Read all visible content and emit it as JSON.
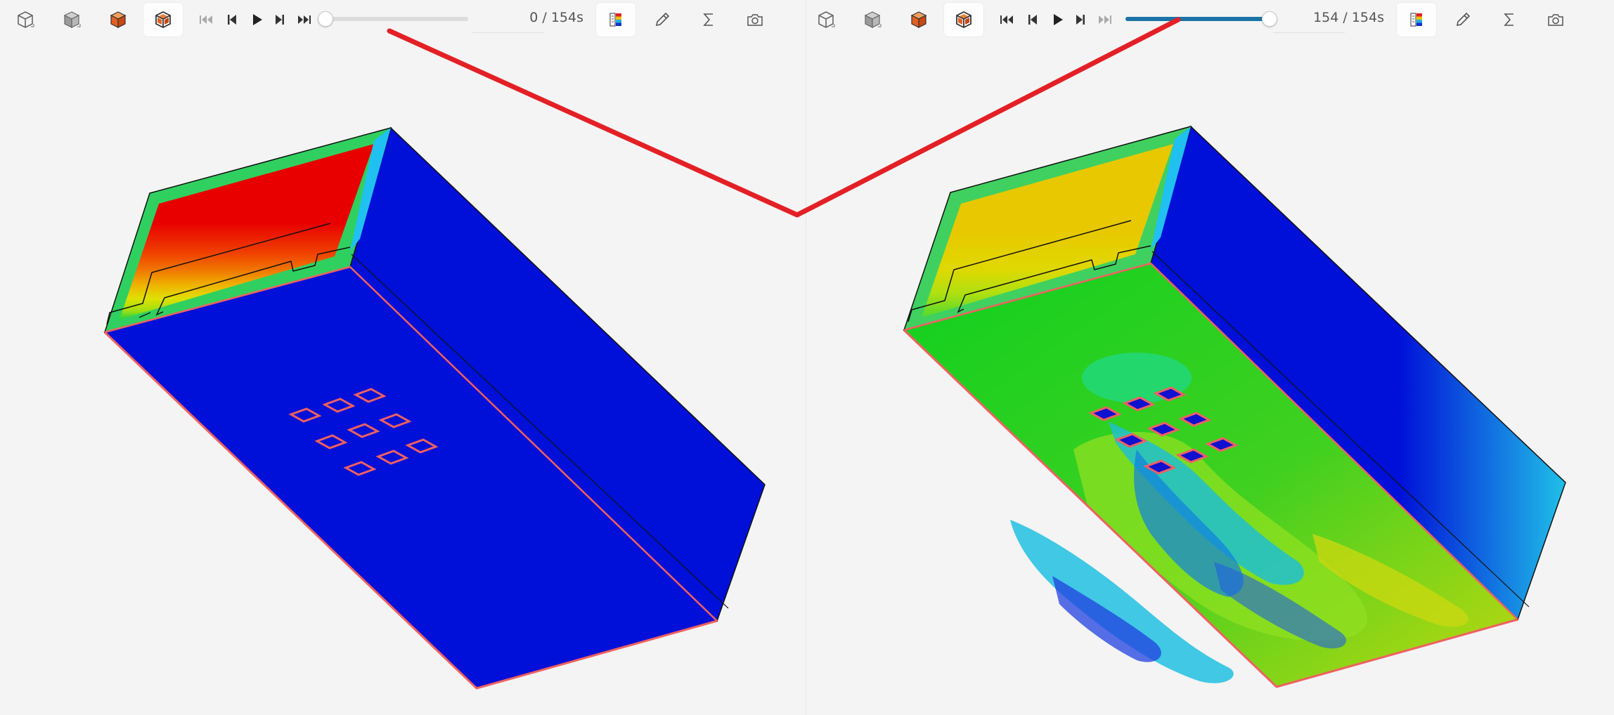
{
  "left_view": {
    "toolbar": {
      "view_buttons": [
        {
          "icon": "wireframe-cube-icon",
          "active": false
        },
        {
          "icon": "solid-cube-icon",
          "active": false
        },
        {
          "icon": "orange-shaded-cube-icon",
          "active": false
        },
        {
          "icon": "orange-edges-cube-icon",
          "active": true
        }
      ],
      "playback": [
        "skip-to-start-icon",
        "step-back-icon",
        "play-icon",
        "step-forward-icon",
        "skip-to-end-icon"
      ],
      "time_readout": "0 / 154s",
      "progress": 0.0,
      "tools": [
        "color-legend-icon",
        "probe-pen-icon",
        "sigma-icon",
        "camera-icon"
      ],
      "active_tool": "color-legend-icon"
    }
  },
  "right_view": {
    "toolbar": {
      "view_buttons": [
        {
          "icon": "wireframe-cube-icon",
          "active": false
        },
        {
          "icon": "solid-cube-icon",
          "active": false
        },
        {
          "icon": "orange-shaded-cube-icon",
          "active": false
        },
        {
          "icon": "orange-edges-cube-icon",
          "active": true
        }
      ],
      "playback": [
        "skip-to-start-icon",
        "step-back-icon",
        "play-icon",
        "step-forward-icon",
        "skip-to-end-icon"
      ],
      "time_readout": "154 / 154s",
      "progress": 1.0,
      "tools": [
        "color-legend-icon",
        "probe-pen-icon",
        "sigma-icon",
        "camera-icon"
      ],
      "active_tool": "color-legend-icon"
    }
  },
  "colors": {
    "annotation_line": "#e32025",
    "slider_fill": "#1a73a8",
    "field_blue": "#0010d8",
    "field_red": "#e80000",
    "field_green": "#10d820",
    "field_yellow": "#e8c800",
    "edge_highlight": "#f06060"
  }
}
